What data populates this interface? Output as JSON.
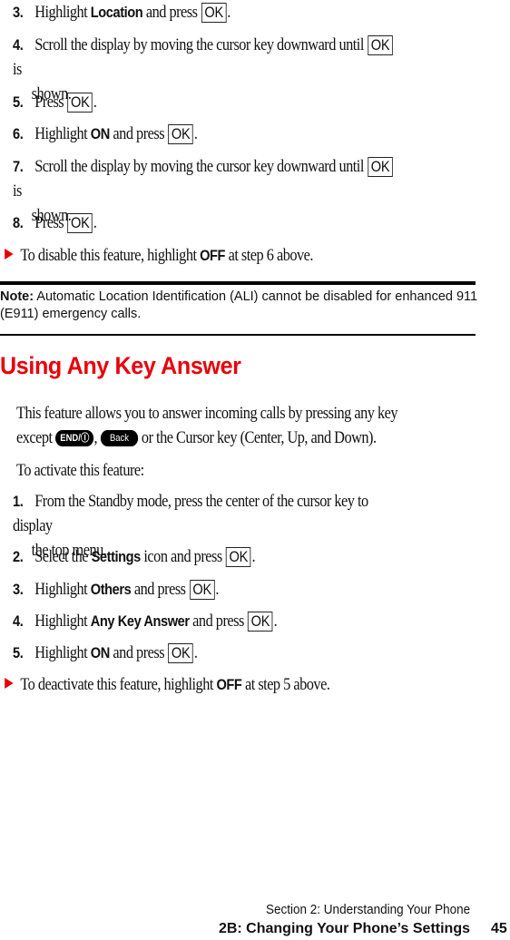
{
  "section1": {
    "steps": [
      {
        "num": "3.",
        "pre": "Highlight",
        "bold": "Location",
        "post": "and press",
        "key": "OK",
        "end": "."
      },
      {
        "num": "4.",
        "pre": "Scroll the display by moving the cursor key downward until",
        "key": "OK",
        "post": "is",
        "cont": "shown."
      },
      {
        "num": "5.",
        "pre": "Press",
        "key": "OK",
        "end": "."
      },
      {
        "num": "6.",
        "pre": "Highlight",
        "bold": "ON",
        "post": "and press",
        "key": "OK",
        "end": "."
      },
      {
        "num": "7.",
        "pre": "Scroll the display by moving the cursor key downward until",
        "key": "OK",
        "post": "is",
        "cont": "shown."
      },
      {
        "num": "8.",
        "pre": "Press",
        "key": "OK",
        "end": "."
      }
    ],
    "tip": {
      "pre": "To disable this feature, highlight",
      "bold": "OFF",
      "post": "at step 6 above."
    }
  },
  "note": {
    "label": "Note:",
    "text": "Automatic Location Identification (ALI) cannot be disabled for enhanced 911 (E911) emergency calls."
  },
  "section2": {
    "heading": "Using Any Key Answer",
    "intro": {
      "line1": "This feature allows you to answer incoming calls by pressing any key",
      "pre": "except",
      "key_end": "END/Ⓘ",
      "sep": ",",
      "key_back": "Back",
      "post": "or the Cursor key (Center, Up, and Down)."
    },
    "activate": "To activate this feature:",
    "steps": [
      {
        "num": "1.",
        "pre": "From the Standby mode, press the center of the cursor key to display",
        "cont": "the top menu."
      },
      {
        "num": "2.",
        "pre": "Select the",
        "bold": "Settings",
        "post": "icon and press",
        "key": "OK",
        "end": "."
      },
      {
        "num": "3.",
        "pre": "Highlight",
        "bold": "Others",
        "post": "and press",
        "key": "OK",
        "end": "."
      },
      {
        "num": "4.",
        "pre": "Highlight",
        "bold": "Any Key Answer",
        "post": "and press",
        "key": "OK",
        "end": "."
      },
      {
        "num": "5.",
        "pre": "Highlight",
        "bold": "ON",
        "post": "and press",
        "key": "OK",
        "end": "."
      }
    ],
    "tip": {
      "pre": "To deactivate this feature, highlight",
      "bold": "OFF",
      "post": "at step 5 above."
    }
  },
  "footer": {
    "section": "Section 2: Understanding Your Phone",
    "chapter": "2B: Changing Your Phone’s Settings",
    "page": "45"
  },
  "colors": {
    "heading": "#e8000b",
    "bullet": "#e60000"
  }
}
